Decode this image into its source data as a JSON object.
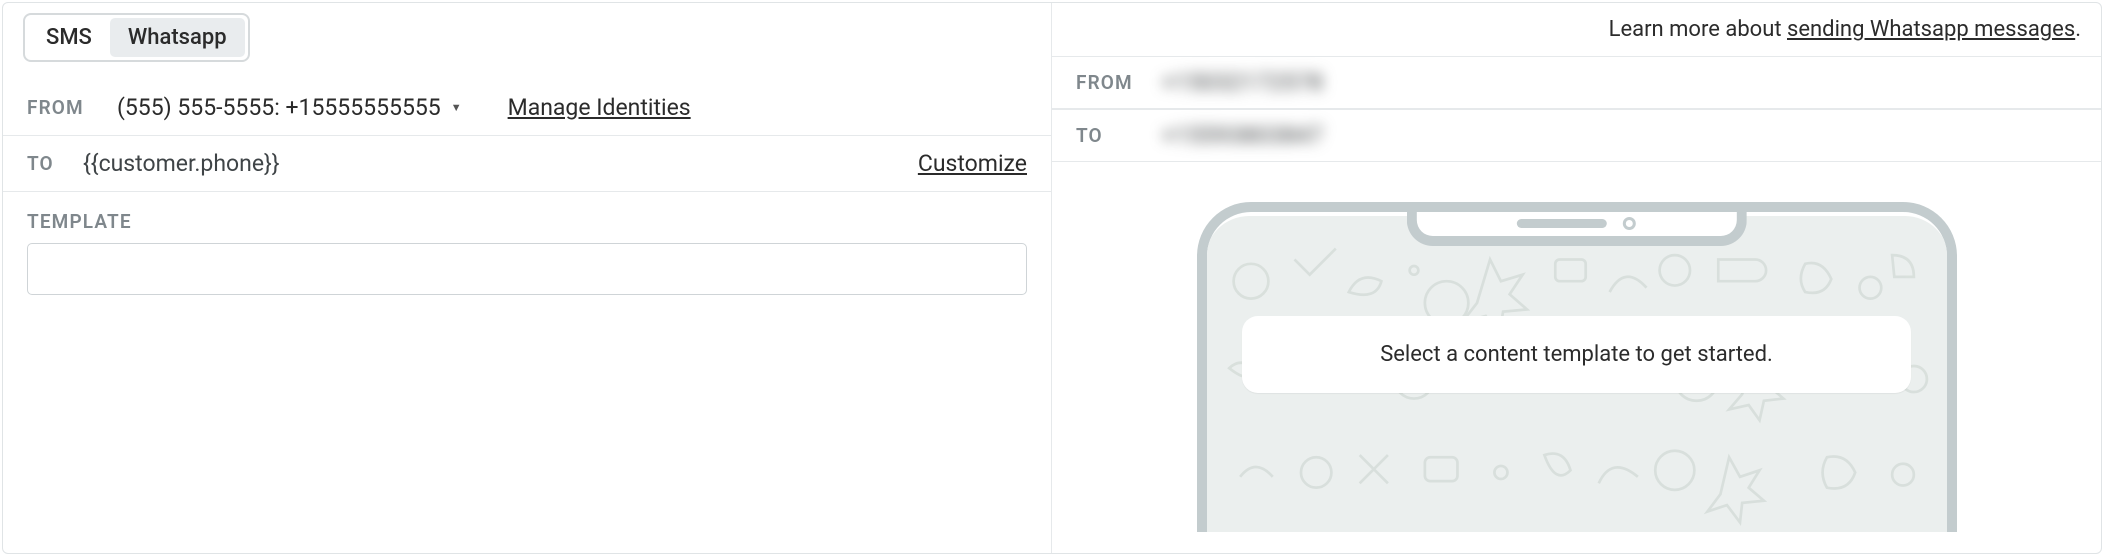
{
  "tabs": {
    "sms": "SMS",
    "whatsapp": "Whatsapp"
  },
  "learn_more": {
    "prefix": "Learn more about ",
    "link_text": "sending Whatsapp messages",
    "suffix": "."
  },
  "left": {
    "from_label": "FROM",
    "from_value": "(555) 555-5555: +15555555555",
    "manage_link": "Manage Identities",
    "to_label": "TO",
    "to_value": "{{customer.phone}}",
    "customize_link": "Customize",
    "template_label": "TEMPLATE",
    "template_value": ""
  },
  "preview": {
    "from_label": "FROM",
    "from_value_masked": "+15032172578",
    "to_label": "TO",
    "to_value_masked": "+15593803847",
    "placeholder_message": "Select a content template to get started."
  }
}
